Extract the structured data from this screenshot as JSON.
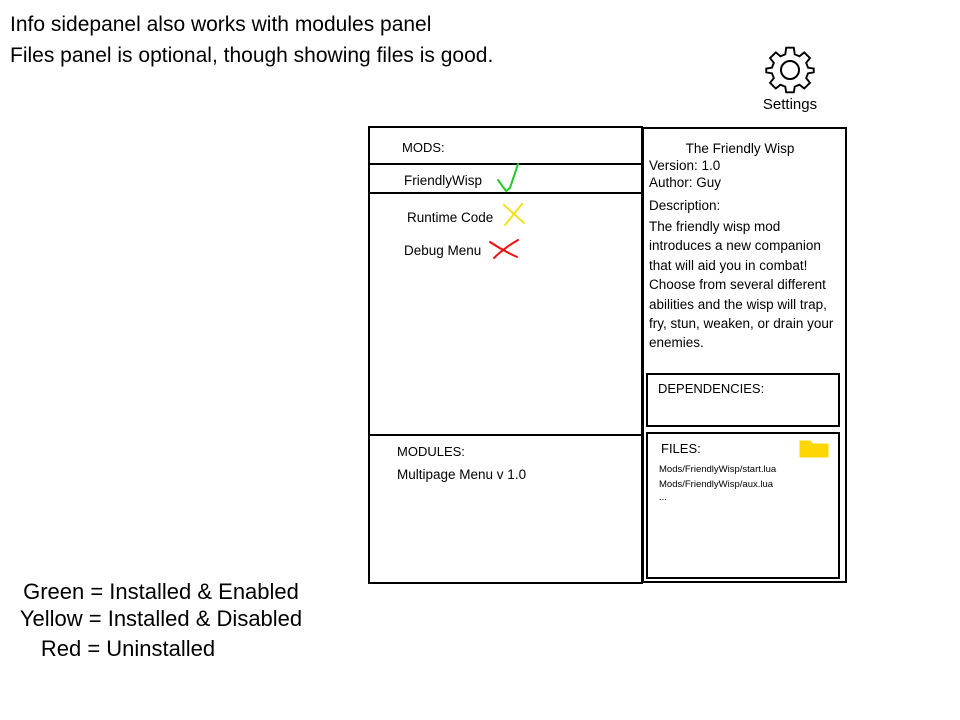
{
  "notes": {
    "line1": "Info sidepanel also works with modules panel",
    "line2": "Files panel is optional, though showing files is good."
  },
  "settings": {
    "label": "Settings",
    "icon": "gear-icon"
  },
  "mods_panel": {
    "heading": "MODS:",
    "items": [
      {
        "label": "FriendlyWisp",
        "status": "installed-enabled",
        "icon": "check-icon",
        "color": "#22cc22"
      },
      {
        "label": "Runtime Code",
        "status": "installed-disabled",
        "icon": "x-icon",
        "color": "#f2e21a"
      },
      {
        "label": "Debug Menu",
        "status": "uninstalled",
        "icon": "x-icon",
        "color": "#ee1111"
      }
    ]
  },
  "modules_panel": {
    "heading": "MODULES:",
    "items": [
      {
        "label": "Multipage Menu v 1.0"
      }
    ]
  },
  "info_panel": {
    "title": "The Friendly Wisp",
    "version": "Version: 1.0",
    "author": "Author: Guy",
    "description_label": "Description:",
    "description": "The friendly wisp mod introduces a new companion that will aid you in combat! Choose from several different abilities and the wisp will trap, fry, stun, weaken, or drain your enemies.",
    "dependencies_heading": "DEPENDENCIES:",
    "files_heading": "FILES:",
    "files_icon": "folder-icon",
    "files": [
      "Mods/FriendlyWisp/start.lua",
      "Mods/FriendlyWisp/aux.lua",
      "..."
    ]
  },
  "legend": {
    "green": "Green = Installed & Enabled",
    "yellow": "Yellow = Installed & Disabled",
    "red": "Red = Uninstalled"
  },
  "colors": {
    "green": "#22cc22",
    "yellow": "#f2e21a",
    "red": "#ee1111",
    "folder": "#ffd700"
  }
}
